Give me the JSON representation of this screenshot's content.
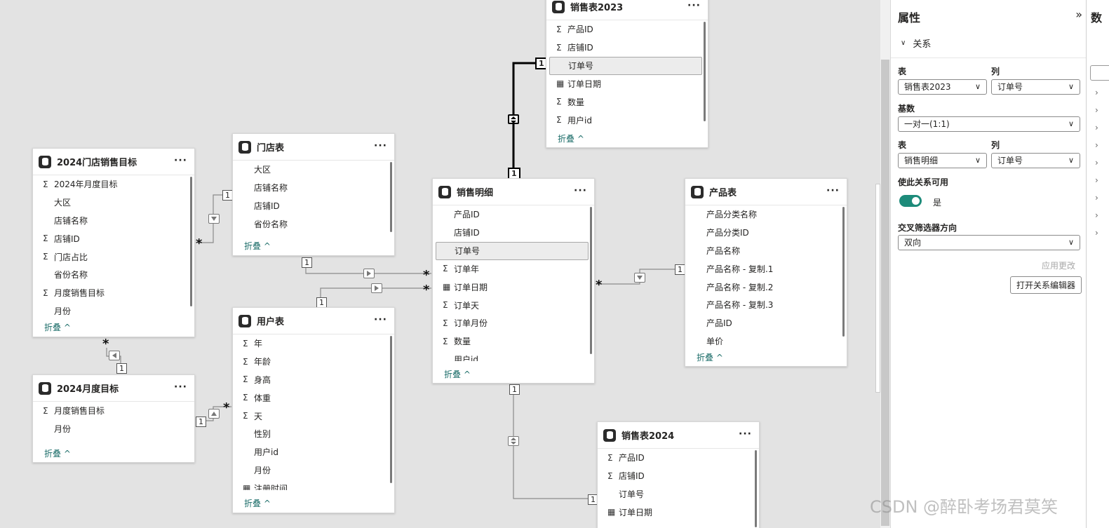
{
  "tables": {
    "target2024": {
      "title": "2024门店销售目标",
      "menu": "···",
      "fields": [
        {
          "icon": "sum",
          "name": "2024年月度目标"
        },
        {
          "icon": "",
          "name": "大区"
        },
        {
          "icon": "",
          "name": "店铺名称"
        },
        {
          "icon": "sum",
          "name": "店铺ID"
        },
        {
          "icon": "sum",
          "name": "门店占比"
        },
        {
          "icon": "",
          "name": "省份名称"
        },
        {
          "icon": "sum",
          "name": "月度销售目标"
        },
        {
          "icon": "",
          "name": "月份"
        }
      ],
      "collapse": "折叠 ^"
    },
    "store": {
      "title": "门店表",
      "menu": "···",
      "fields": [
        {
          "icon": "",
          "name": "大区"
        },
        {
          "icon": "",
          "name": "店铺名称"
        },
        {
          "icon": "",
          "name": "店铺ID"
        },
        {
          "icon": "",
          "name": "省份名称"
        }
      ],
      "collapse": "折叠 ^"
    },
    "sales2023": {
      "title": "销售表2023",
      "menu": "···",
      "fields": [
        {
          "icon": "sum",
          "name": "产品ID"
        },
        {
          "icon": "sum",
          "name": "店铺ID"
        },
        {
          "icon": "",
          "name": "订单号",
          "selected": true
        },
        {
          "icon": "cal",
          "name": "订单日期"
        },
        {
          "icon": "sum",
          "name": "数量"
        },
        {
          "icon": "sum",
          "name": "用户id"
        }
      ],
      "collapse": "折叠 ^"
    },
    "salesDetail": {
      "title": "销售明细",
      "menu": "···",
      "fields": [
        {
          "icon": "",
          "name": "产品ID"
        },
        {
          "icon": "",
          "name": "店铺ID"
        },
        {
          "icon": "",
          "name": "订单号",
          "selected": true
        },
        {
          "icon": "sum",
          "name": "订单年"
        },
        {
          "icon": "cal",
          "name": "订单日期"
        },
        {
          "icon": "sum",
          "name": "订单天"
        },
        {
          "icon": "sum",
          "name": "订单月份"
        },
        {
          "icon": "sum",
          "name": "数量"
        },
        {
          "icon": "",
          "name": "用户id"
        }
      ],
      "collapse": "折叠 ^"
    },
    "product": {
      "title": "产品表",
      "menu": "···",
      "fields": [
        {
          "icon": "",
          "name": "产品分类名称"
        },
        {
          "icon": "",
          "name": "产品分类ID"
        },
        {
          "icon": "",
          "name": "产品名称"
        },
        {
          "icon": "",
          "name": "产品名称 - 复制.1"
        },
        {
          "icon": "",
          "name": "产品名称 - 复制.2"
        },
        {
          "icon": "",
          "name": "产品名称 - 复制.3"
        },
        {
          "icon": "",
          "name": "产品ID"
        },
        {
          "icon": "",
          "name": "单价"
        }
      ],
      "collapse": "折叠 ^"
    },
    "users": {
      "title": "用户表",
      "menu": "···",
      "fields": [
        {
          "icon": "sum",
          "name": "年"
        },
        {
          "icon": "sum",
          "name": "年龄"
        },
        {
          "icon": "sum",
          "name": "身高"
        },
        {
          "icon": "sum",
          "name": "体重"
        },
        {
          "icon": "sum",
          "name": "天"
        },
        {
          "icon": "",
          "name": "性别"
        },
        {
          "icon": "",
          "name": "用户id"
        },
        {
          "icon": "",
          "name": "月份"
        },
        {
          "icon": "cal",
          "name": "注册时间"
        }
      ],
      "collapse": "折叠 ^"
    },
    "monthTarget": {
      "title": "2024月度目标",
      "menu": "···",
      "fields": [
        {
          "icon": "sum",
          "name": "月度销售目标"
        },
        {
          "icon": "",
          "name": "月份"
        }
      ],
      "collapse": "折叠 ^"
    },
    "sales2024": {
      "title": "销售表2024",
      "menu": "···",
      "fields": [
        {
          "icon": "sum",
          "name": "产品ID"
        },
        {
          "icon": "sum",
          "name": "店铺ID"
        },
        {
          "icon": "",
          "name": "订单号"
        },
        {
          "icon": "cal",
          "name": "订单日期"
        }
      ],
      "collapse": ""
    }
  },
  "cardinality": {
    "one": "1",
    "many": "*"
  },
  "icons": {
    "sum": "Σ",
    "cal": "▦",
    "db": "database-icon"
  },
  "properties": {
    "title": "属性",
    "collapse_icon": "»",
    "section": "关系",
    "table_label": "表",
    "column_label": "列",
    "table1": "销售表2023",
    "column1": "订单号",
    "cardinality_label": "基数",
    "cardinality_value": "一对一(1:1)",
    "table2": "销售明细",
    "column2": "订单号",
    "active_label": "使此关系可用",
    "active_value": "是",
    "filter_label": "交叉筛选器方向",
    "filter_value": "双向",
    "apply_button": "应用更改",
    "open_editor_button": "打开关系编辑器"
  },
  "data_pane": {
    "title": "数"
  },
  "watermark": "CSDN @醉卧考场君莫笑",
  "colors": {
    "accent": "#1d8b7a",
    "link": "#1d6e6a"
  }
}
